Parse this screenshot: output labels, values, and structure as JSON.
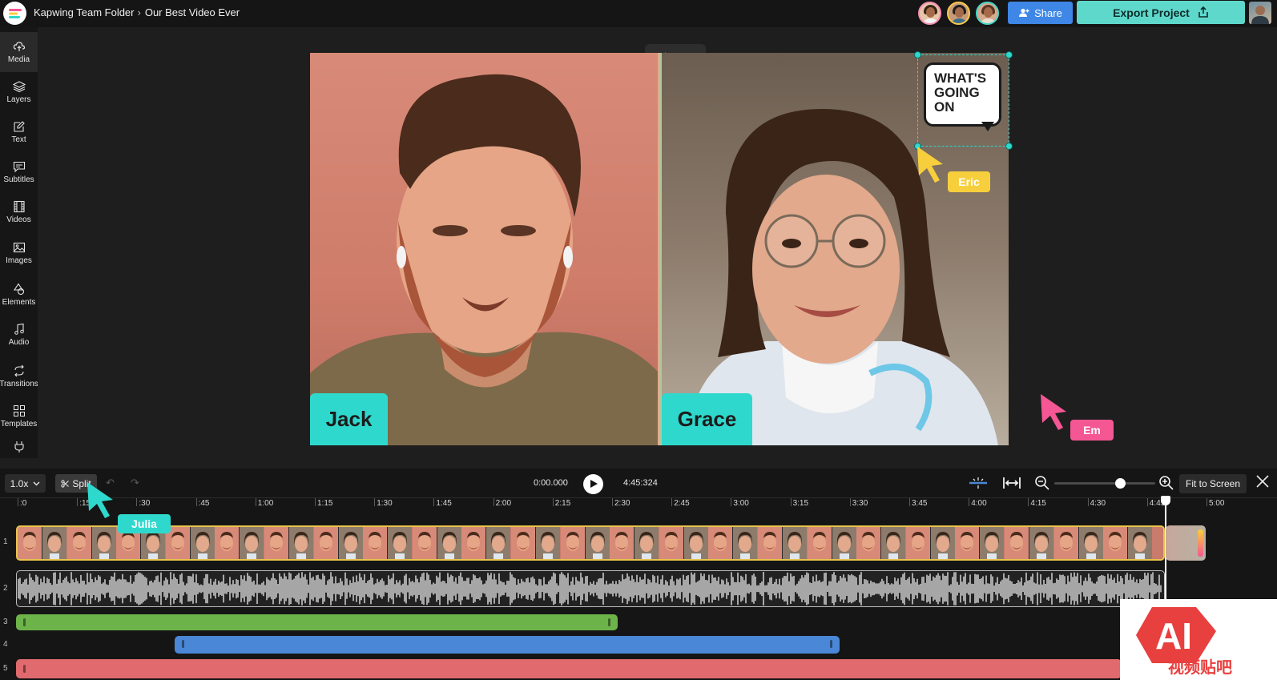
{
  "topbar": {
    "folder": "Kapwing Team Folder",
    "separator": "›",
    "project_title": "Our Best Video Ever",
    "share_label": "Share",
    "export_label": "Export Project"
  },
  "sidebar": {
    "items": [
      {
        "label": "Media",
        "icon": "upload-cloud-icon"
      },
      {
        "label": "Layers",
        "icon": "layers-icon"
      },
      {
        "label": "Text",
        "icon": "edit-text-icon"
      },
      {
        "label": "Subtitles",
        "icon": "subtitles-icon"
      },
      {
        "label": "Videos",
        "icon": "film-icon"
      },
      {
        "label": "Images",
        "icon": "image-icon"
      },
      {
        "label": "Elements",
        "icon": "shapes-icon"
      },
      {
        "label": "Audio",
        "icon": "music-note-icon"
      },
      {
        "label": "Transitions",
        "icon": "transition-icon"
      },
      {
        "label": "Templates",
        "icon": "grid-icon"
      }
    ],
    "plugins_icon": "plug-icon"
  },
  "canvas": {
    "left_name": "Jack",
    "right_name": "Grace",
    "sticker_lines": [
      "WHAT'S",
      "GOING",
      "ON"
    ]
  },
  "collaborators": {
    "eric": "Eric",
    "em": "Em",
    "julia": "Julia",
    "colors": {
      "eric": "#f7cf3c",
      "em": "#f45794",
      "julia": "#2fd8cd"
    }
  },
  "timeline": {
    "speed": "1.0x",
    "split_label": "Split",
    "current_time": "0:00.000",
    "total_time": "4:45:324",
    "fit_label": "Fit to Screen",
    "zoom_level": 0.65,
    "ruler_labels": [
      ":0",
      ":15",
      ":30",
      ":45",
      "1:00",
      "1:15",
      "1:30",
      "1:45",
      "2:00",
      "2:15",
      "2:30",
      "2:45",
      "3:00",
      "3:15",
      "3:30",
      "3:45",
      "4:00",
      "4:15",
      "4:30",
      "4:45",
      "5:00"
    ],
    "track_numbers": [
      "1",
      "2",
      "3",
      "4",
      "5"
    ]
  },
  "watermark": {
    "logo_text": "AI",
    "sub_text": "视频贴吧"
  },
  "colors": {
    "accent": "#5fd8cc",
    "share": "#3e87e6",
    "track_green": "#6cb34a",
    "track_blue": "#4a87d6",
    "track_red": "#e06a6e"
  }
}
